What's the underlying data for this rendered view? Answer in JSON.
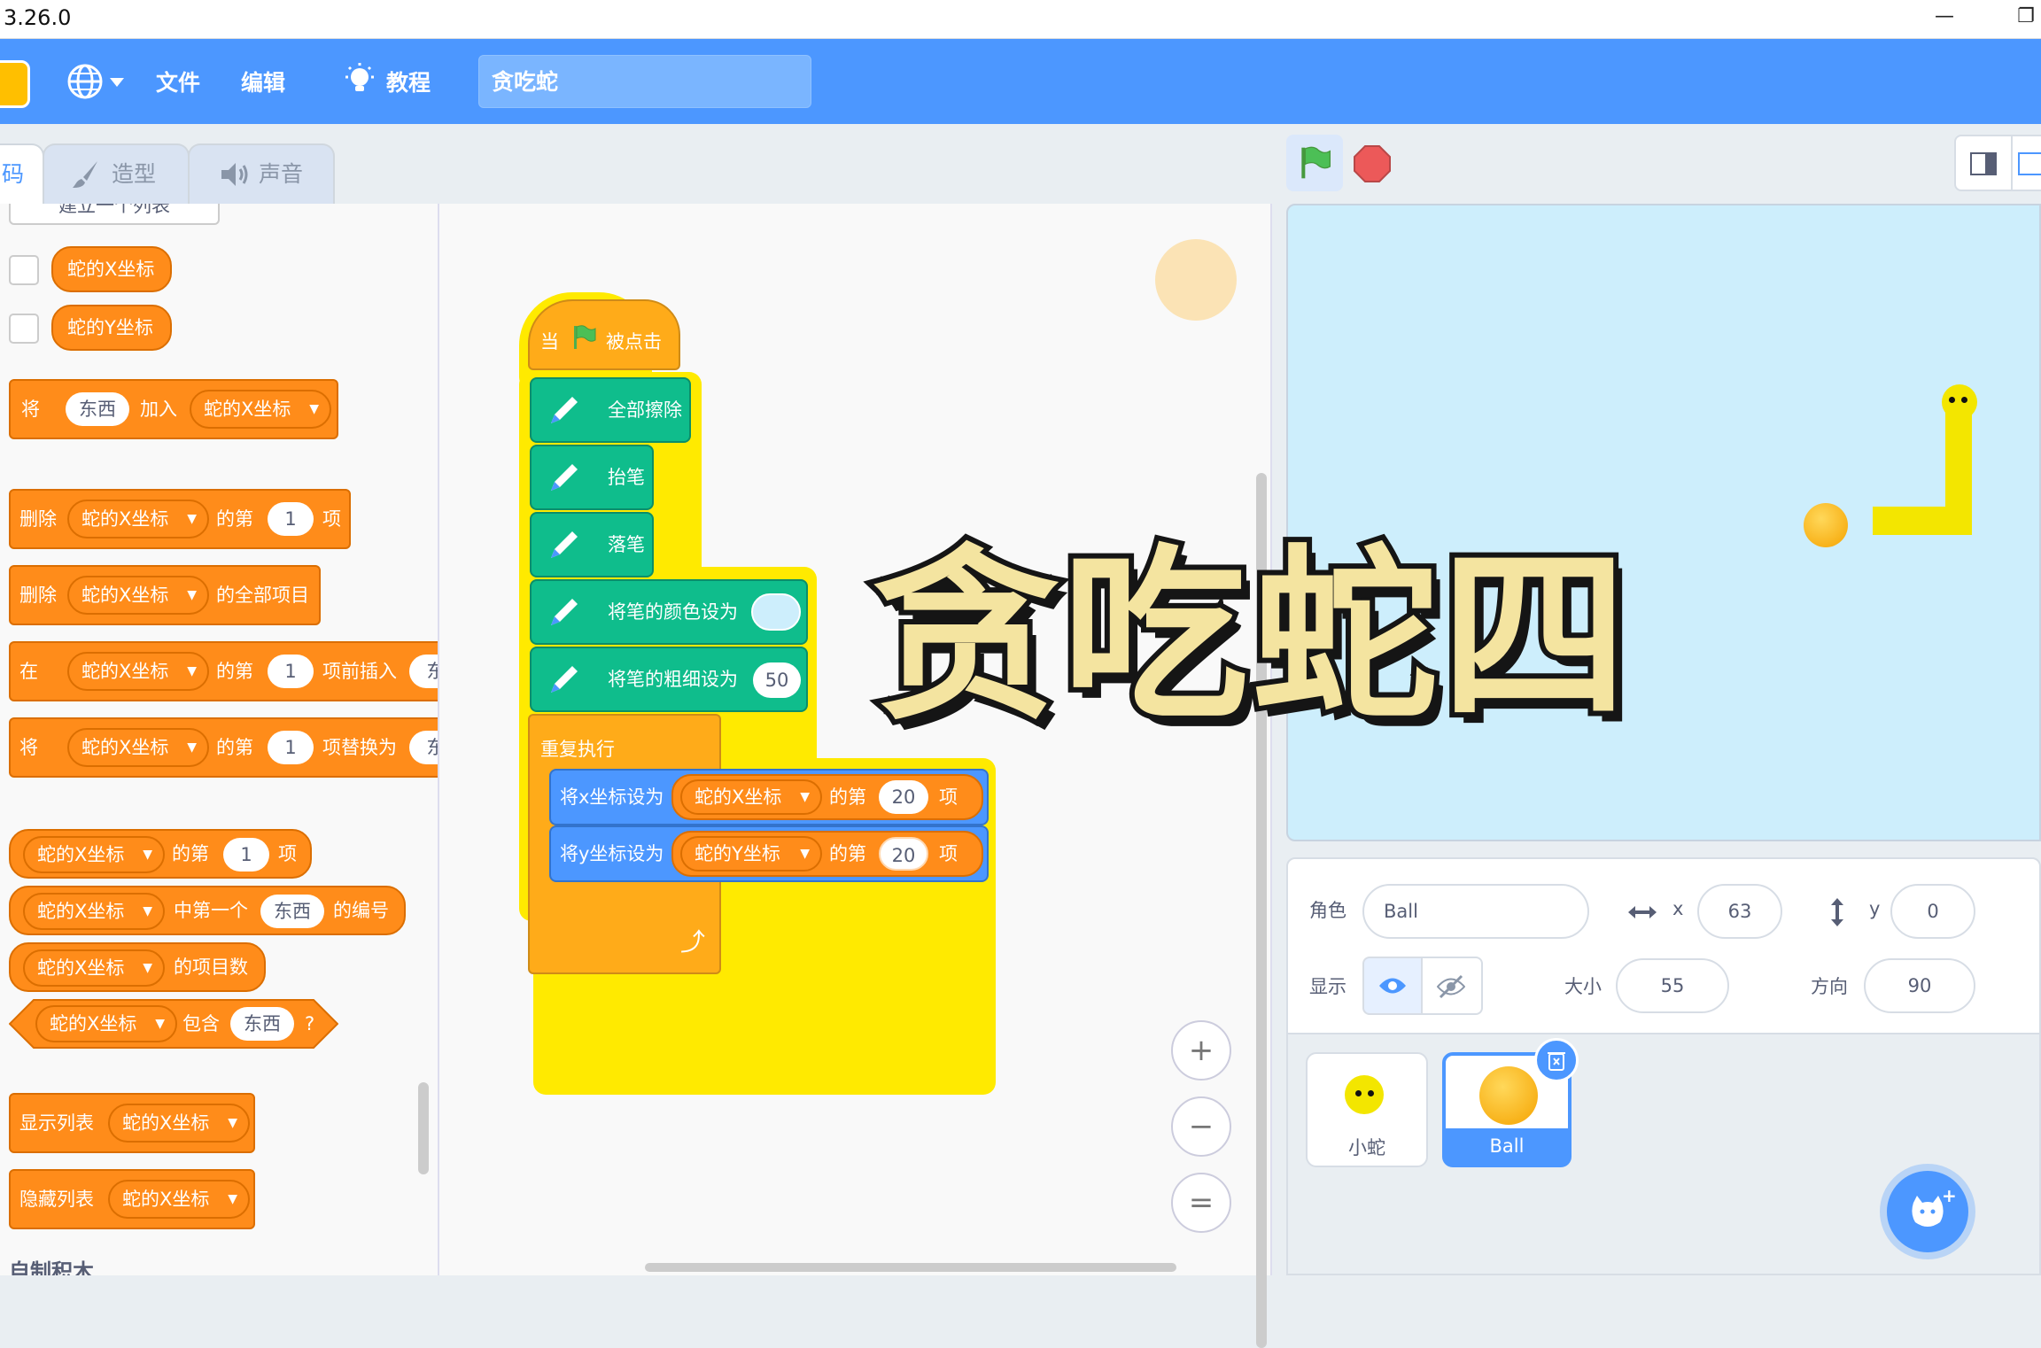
{
  "titlebar": {
    "version": "3.26.0",
    "minimize_glyph": "—",
    "restore_glyph": "❐"
  },
  "menu": {
    "language_icon": "globe-icon",
    "file": "文件",
    "edit": "编辑",
    "tutorials": "教程",
    "project_title": "贪吃蛇"
  },
  "tabs": {
    "code_partial": "码",
    "costumes": "造型",
    "sounds": "声音"
  },
  "palette": {
    "make_list_partial": "建立一个列表",
    "var_x": "蛇的X坐标",
    "var_y": "蛇的Y坐标",
    "add_block": {
      "w1": "将",
      "thing": "东西",
      "w2": "加入",
      "list": "蛇的X坐标"
    },
    "delete_item": {
      "w1": "删除",
      "list": "蛇的X坐标",
      "w2": "的第",
      "n": "1",
      "w3": "项"
    },
    "delete_all": {
      "w1": "删除",
      "list": "蛇的X坐标",
      "w2": "的全部项目"
    },
    "insert": {
      "w1": "在",
      "list": "蛇的X坐标",
      "w2": "的第",
      "n": "1",
      "w3": "项前插入",
      "thing": "东"
    },
    "replace": {
      "w1": "将",
      "list": "蛇的X坐标",
      "w2": "的第",
      "n": "1",
      "w3": "项替换为",
      "thing": "东"
    },
    "item_of": {
      "list": "蛇的X坐标",
      "w2": "的第",
      "n": "1",
      "w3": "项"
    },
    "index_of": {
      "list": "蛇的X坐标",
      "w2": "中第一个",
      "thing": "东西",
      "w3": "的编号"
    },
    "length": {
      "list": "蛇的X坐标",
      "w2": "的项目数"
    },
    "contains": {
      "list": "蛇的X坐标",
      "w2": "包含",
      "thing": "东西",
      "q": "?"
    },
    "show_list": {
      "w1": "显示列表",
      "list": "蛇的X坐标"
    },
    "hide_list": {
      "w1": "隐藏列表",
      "list": "蛇的X坐标"
    },
    "my_blocks_partial": "自制积木"
  },
  "script": {
    "hat": {
      "w1": "当",
      "w2": "被点击"
    },
    "clear": "全部擦除",
    "pen_up": "抬笔",
    "pen_down": "落笔",
    "set_color": "将笔的颜色设为",
    "set_size": "将笔的粗细设为",
    "size_value": "50",
    "forever": "重复执行",
    "set_x": {
      "w1": "将x坐标设为",
      "list": "蛇的X坐标",
      "w2": "的第",
      "n": "20",
      "w3": "项"
    },
    "set_y": {
      "w1": "将y坐标设为",
      "list": "蛇的Y坐标",
      "w2": "的第",
      "n": "20",
      "w3": "项"
    },
    "loop_arrow": "⤴",
    "zoom_in": "+",
    "zoom_out": "−",
    "zoom_reset": "="
  },
  "overlay_title": "贪吃蛇四",
  "sprite_info": {
    "sprite_label": "角色",
    "sprite_name": "Ball",
    "x_label": "x",
    "x_value": "63",
    "y_label": "y",
    "y_value": "0",
    "show_label": "显示",
    "size_label": "大小",
    "size_value": "55",
    "direction_label": "方向",
    "direction_value": "90"
  },
  "sprites": [
    {
      "name": "小蛇",
      "selected": false
    },
    {
      "name": "Ball",
      "selected": true
    }
  ],
  "colors": {
    "menu_blue": "#4c97ff",
    "list_orange": "#ff8c1a",
    "events_yellow": "#ffab19",
    "pen_green": "#0fbd8c",
    "motion_blue": "#4c97ff",
    "stage_bg": "#cdeefc"
  }
}
